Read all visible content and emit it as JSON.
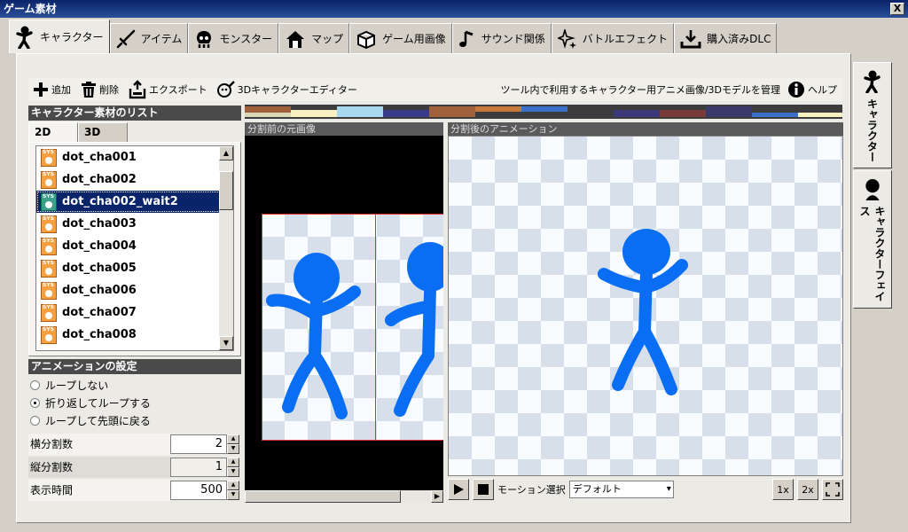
{
  "window": {
    "title": "ゲーム素材",
    "close_label": "X"
  },
  "main_tabs": [
    {
      "label": "キャラクター",
      "icon": "character-icon"
    },
    {
      "label": "アイテム",
      "icon": "sword-icon"
    },
    {
      "label": "モンスター",
      "icon": "skull-icon"
    },
    {
      "label": "マップ",
      "icon": "house-icon"
    },
    {
      "label": "ゲーム用画像",
      "icon": "box-icon"
    },
    {
      "label": "サウンド関係",
      "icon": "music-note-icon"
    },
    {
      "label": "バトルエフェクト",
      "icon": "sparkle-icon"
    },
    {
      "label": "購入済みDLC",
      "icon": "download-icon"
    }
  ],
  "toolbar": {
    "add_label": "追加",
    "delete_label": "削除",
    "export_label": "エクスポート",
    "editor_label": "3Dキャラクターエディター",
    "description": "ツール内で利用するキャラクター用アニメ画像/3Dモデルを管理",
    "help_label": "ヘルプ"
  },
  "list_section": {
    "title": "キャラクター素材のリスト",
    "tabs": [
      "2D",
      "3D"
    ],
    "items": [
      "dot_cha001",
      "dot_cha002",
      "dot_cha002_wait2",
      "dot_cha003",
      "dot_cha004",
      "dot_cha005",
      "dot_cha006",
      "dot_cha007",
      "dot_cha008"
    ],
    "selected_index": 2
  },
  "animation": {
    "title": "アニメーションの設定",
    "options": [
      "ループしない",
      "折り返してループする",
      "ループして先頭に戻る"
    ],
    "selected_index": 1,
    "fields": [
      {
        "label": "横分割数",
        "value": "2"
      },
      {
        "label": "縦分割数",
        "value": "1"
      },
      {
        "label": "表示時間",
        "value": "500"
      }
    ]
  },
  "preview": {
    "source_label": "分割前の元画像",
    "animated_label": "分割後のアニメーション",
    "motion_label": "モーション選択",
    "motion_value": "デフォルト",
    "zoom_1x": "1x",
    "zoom_2x": "2x"
  },
  "side_tabs": [
    {
      "label": "キャラクター",
      "icon": "character-icon"
    },
    {
      "label": "キャラクターフェイス",
      "icon": "face-icon"
    }
  ],
  "colors": {
    "figure": "#0a6ef5",
    "selection": "#0a246a",
    "red_frame": "#e03030"
  }
}
